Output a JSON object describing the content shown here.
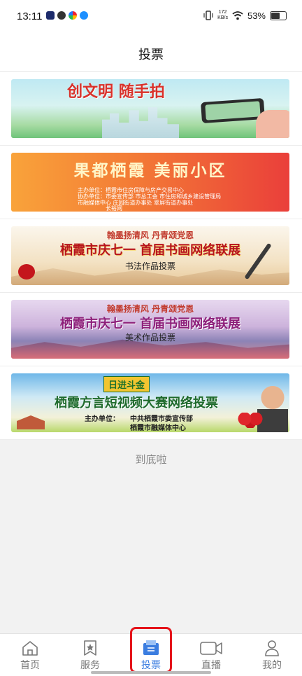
{
  "status_bar": {
    "time": "13:11",
    "netspeed_value": "172",
    "netspeed_unit": "KB/s",
    "battery": "53%",
    "battery_level": 0.53
  },
  "header": {
    "title": "投票"
  },
  "banners": [
    {
      "title": "创文明 随手拍"
    },
    {
      "title": "果都栖霞 美丽小区",
      "sponsor_lines": [
        "主办单位：栖霞市住房保障与房产交易中心",
        "协办单位：市委宣传部 市总工会 市住房和城乡建设管理局",
        "市融媒体中心 庄园街道办事处 翠屏街道办事处",
        "长裕网"
      ]
    },
    {
      "slogan": "翰墨扬清风 丹青颂党恩",
      "title": "栖霞市庆七一 首届书画网络联展",
      "subtitle": "书法作品投票"
    },
    {
      "slogan": "翰墨扬清风 丹青颂党恩",
      "title": "栖霞市庆七一 首届书画网络联展",
      "subtitle": "美术作品投票"
    },
    {
      "badge": "日进斗金",
      "title": "栖霞方言短视频大赛网络投票",
      "sponsor_label": "主办单位：",
      "sponsors": [
        "中共栖霞市委宣传部",
        "栖霞市融媒体中心"
      ]
    }
  ],
  "end_text": "到底啦",
  "tabs": [
    {
      "label": "首页",
      "icon": "home-icon"
    },
    {
      "label": "服务",
      "icon": "star-bookmark-icon"
    },
    {
      "label": "投票",
      "icon": "ballot-box-icon",
      "active": true
    },
    {
      "label": "直播",
      "icon": "video-camera-icon"
    },
    {
      "label": "我的",
      "icon": "person-icon"
    }
  ],
  "colors": {
    "accent": "#3b7de0",
    "highlight_box": "#e5141b"
  }
}
